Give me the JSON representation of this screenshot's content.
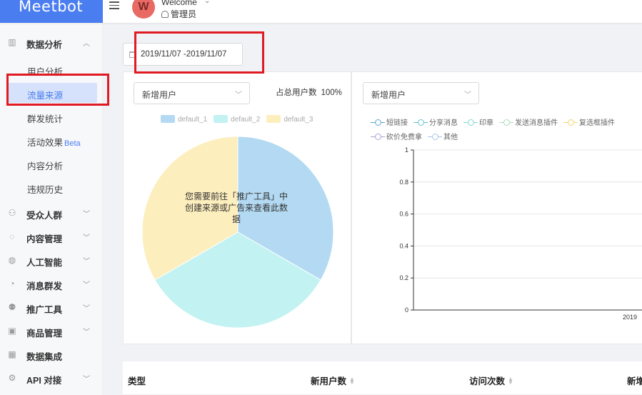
{
  "header": {
    "logo": "Meetbot",
    "avatar_letter": "W",
    "welcome": "Welcome",
    "role": "管理员"
  },
  "sidebar": {
    "groups": [
      {
        "label": "数据分析",
        "icon": "bar-chart-icon",
        "expanded": true
      },
      {
        "label": "受众人群",
        "icon": "users-icon"
      },
      {
        "label": "内容管理",
        "icon": "chat-icon"
      },
      {
        "label": "人工智能",
        "icon": "brain-icon"
      },
      {
        "label": "消息群发",
        "icon": "clock-icon"
      },
      {
        "label": "推广工具",
        "icon": "megaphone-icon"
      },
      {
        "label": "商品管理",
        "icon": "box-icon"
      },
      {
        "label": "数据集成",
        "icon": "grid-icon"
      },
      {
        "label": "API 对接",
        "icon": "api-icon"
      }
    ],
    "subitems": [
      {
        "label": "用户分析"
      },
      {
        "label": "流量来源",
        "active": true
      },
      {
        "label": "群发统计"
      },
      {
        "label": "活动效果",
        "badge": "Beta"
      },
      {
        "label": "内容分析"
      },
      {
        "label": "违规历史"
      }
    ]
  },
  "filters": {
    "date_range": "2019/11/07 -2019/11/07"
  },
  "left_panel": {
    "select_value": "新增用户",
    "ratio_label": "占总用户数",
    "ratio_value": "100%",
    "empty_message": "您需要前往「推广工具」中创建来源或广告来查看此数据"
  },
  "right_panel": {
    "select_value": "新增用户"
  },
  "colors": {
    "accent": "#4a7df0",
    "annotation": "#e01a22"
  },
  "chart_data": [
    {
      "type": "pie",
      "categories": [
        "default_1",
        "default_2",
        "default_3"
      ],
      "values": [
        1,
        1,
        1
      ],
      "colors": [
        "#b3daf2",
        "#c2f2f2",
        "#fdeebd"
      ],
      "legend": "top"
    },
    {
      "type": "line",
      "series": [
        {
          "name": "短链接",
          "values": [],
          "color": "#5aa9c9"
        },
        {
          "name": "分享消息",
          "values": [],
          "color": "#62c3cf"
        },
        {
          "name": "印章",
          "values": [],
          "color": "#7fd8d0"
        },
        {
          "name": "发送消息插件",
          "values": [],
          "color": "#a8dcb8"
        },
        {
          "name": "复选框插件",
          "values": [],
          "color": "#f5d66a"
        },
        {
          "name": "砍价免费拿",
          "values": [],
          "color": "#a9a4d8"
        },
        {
          "name": "其他",
          "values": [],
          "color": "#a9c4e8"
        }
      ],
      "ylim": [
        0,
        1
      ],
      "yticks": [
        "0",
        "0.2",
        "0.4",
        "0.6",
        "0.8",
        "1"
      ],
      "x": [
        "2019"
      ],
      "grid": true,
      "legend": "top"
    }
  ],
  "table": {
    "columns": [
      {
        "label": "类型",
        "sortable": false
      },
      {
        "label": "新用户数",
        "sortable": true
      },
      {
        "label": "访问次数",
        "sortable": true
      },
      {
        "label": "新增",
        "sortable": false
      }
    ]
  }
}
